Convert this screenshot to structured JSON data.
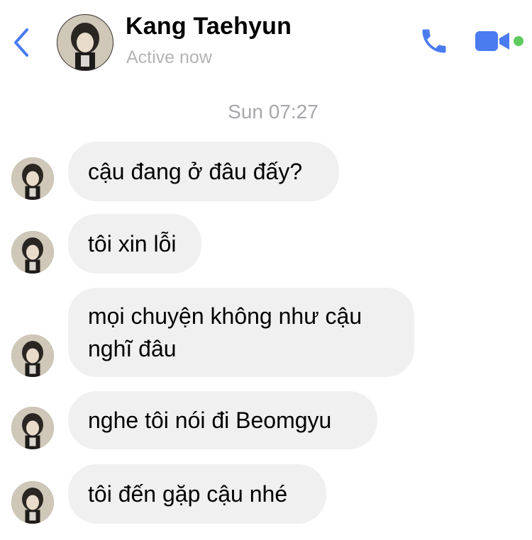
{
  "header": {
    "contact_name": "Kang Taehyun",
    "status": "Active now",
    "accent_color": "#4a7cf0",
    "online_color": "#5ecb5e",
    "icons": {
      "back": "chevron-left-icon",
      "call": "phone-icon",
      "video": "video-camera-icon"
    }
  },
  "conversation": {
    "timestamp": "Sun 07:27",
    "messages": [
      {
        "text": "cậu đang ở đâu đấy?"
      },
      {
        "text": "tôi xin lỗi"
      },
      {
        "line1": "mọi chuyện không như cậu",
        "line2": "nghĩ đâu"
      },
      {
        "text": "nghe tôi nói đi Beomgyu"
      },
      {
        "text": "tôi đến gặp cậu nhé"
      }
    ],
    "bubble_color": "#f0f0f0"
  }
}
